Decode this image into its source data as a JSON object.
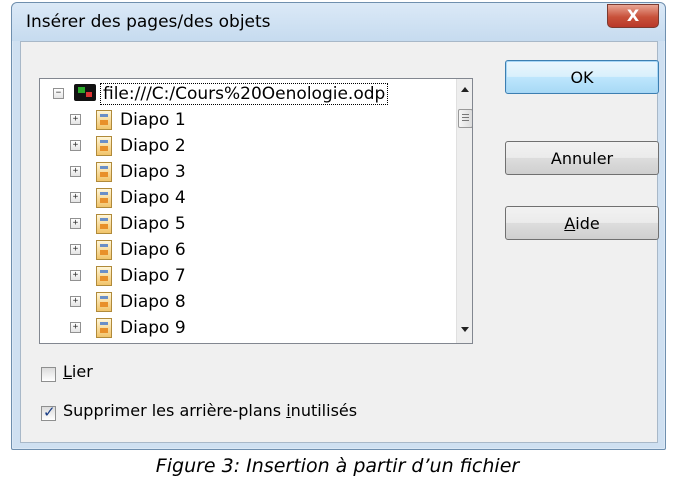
{
  "dialog": {
    "title": "Insérer des pages/des objets",
    "close_glyph": "X"
  },
  "tree": {
    "root": {
      "label": "file:///C:/Cours%20Oenologie.odp",
      "expander": "−",
      "icon": "presentation-file-icon"
    },
    "items": [
      {
        "label": "Diapo 1",
        "expander": "+"
      },
      {
        "label": "Diapo 2",
        "expander": "+"
      },
      {
        "label": "Diapo 3",
        "expander": "+"
      },
      {
        "label": "Diapo 4",
        "expander": "+"
      },
      {
        "label": "Diapo 5",
        "expander": "+"
      },
      {
        "label": "Diapo 6",
        "expander": "+"
      },
      {
        "label": "Diapo 7",
        "expander": "+"
      },
      {
        "label": "Diapo 8",
        "expander": "+"
      },
      {
        "label": "Diapo 9",
        "expander": "+"
      }
    ],
    "item_icon": "slide-icon"
  },
  "buttons": {
    "ok": "OK",
    "cancel": "Annuler",
    "help_mnemonic": "A",
    "help_rest": "ide"
  },
  "options": {
    "link": {
      "mnemonic": "L",
      "rest": "ier",
      "checked": false
    },
    "delete_backgrounds": {
      "before": "Supprimer les arrière-plans ",
      "mnemonic": "i",
      "after": "nutilisés",
      "checked": true
    }
  },
  "caption": "Figure 3: Insertion à partir d’un fichier"
}
